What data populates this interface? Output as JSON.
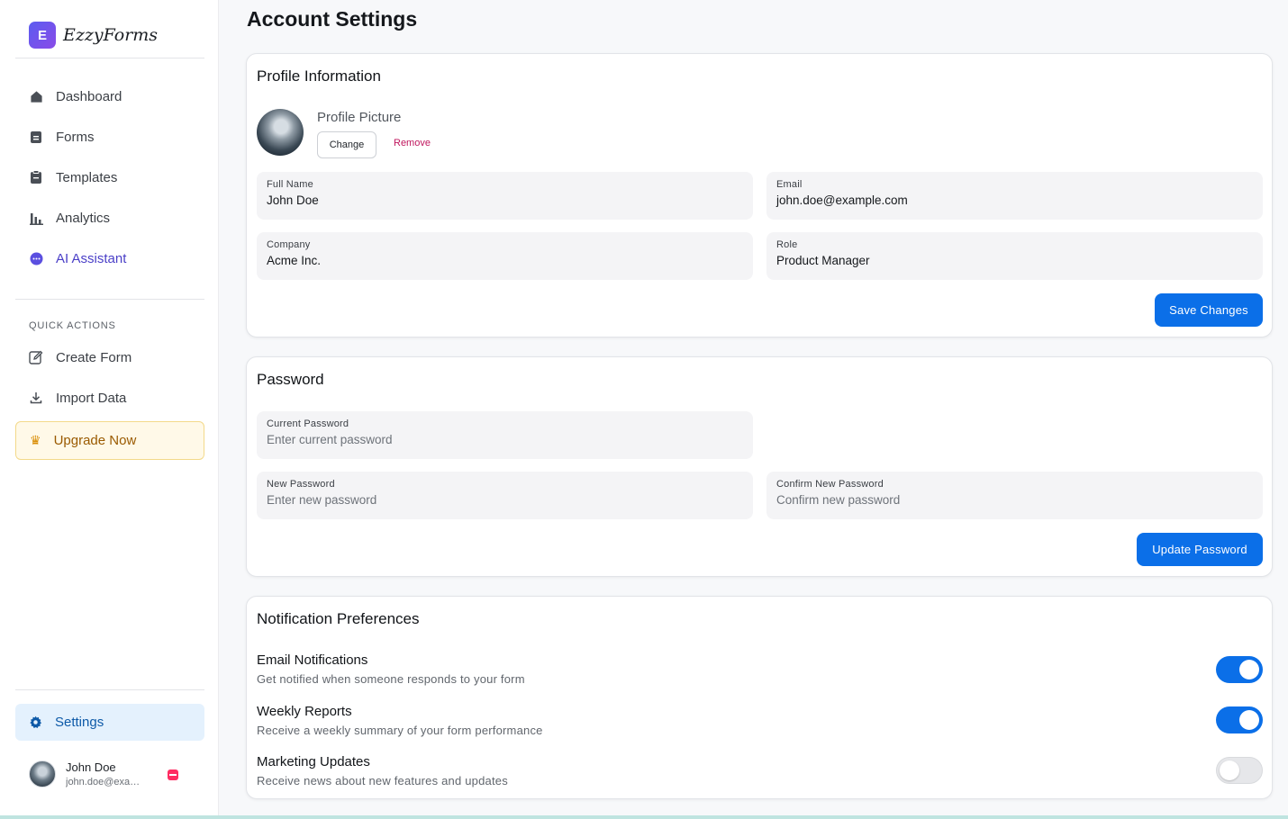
{
  "brand": {
    "badge": "E",
    "name": "EzzyForms"
  },
  "sidebar": {
    "nav": [
      {
        "label": "Dashboard",
        "icon": "home-icon"
      },
      {
        "label": "Forms",
        "icon": "document-icon"
      },
      {
        "label": "Templates",
        "icon": "clipboard-icon"
      },
      {
        "label": "Analytics",
        "icon": "bar-chart-icon"
      },
      {
        "label": "AI Assistant",
        "icon": "chat-bubble-icon"
      }
    ],
    "quick_actions_title": "QUICK ACTIONS",
    "quick_actions": [
      {
        "label": "Create Form",
        "icon": "edit-icon"
      },
      {
        "label": "Import Data",
        "icon": "download-icon"
      }
    ],
    "upgrade_label": "Upgrade Now",
    "settings_label": "Settings",
    "user": {
      "name": "John Doe",
      "email": "john.doe@example.com"
    }
  },
  "page": {
    "title": "Account Settings"
  },
  "profile": {
    "title": "Profile Information",
    "picture_label": "Profile Picture",
    "change_label": "Change",
    "remove_label": "Remove",
    "fields": {
      "full_name": {
        "label": "Full Name",
        "value": "John Doe"
      },
      "email": {
        "label": "Email",
        "value": "john.doe@example.com"
      },
      "company": {
        "label": "Company",
        "value": "Acme Inc."
      },
      "role": {
        "label": "Role",
        "value": "Product Manager"
      }
    },
    "save_label": "Save Changes"
  },
  "password": {
    "title": "Password",
    "fields": {
      "current": {
        "label": "Current Password",
        "placeholder": "Enter current password"
      },
      "new": {
        "label": "New Password",
        "placeholder": "Enter new password"
      },
      "confirm": {
        "label": "Confirm New Password",
        "placeholder": "Confirm new password"
      }
    },
    "update_label": "Update Password"
  },
  "notifications": {
    "title": "Notification Preferences",
    "items": [
      {
        "title": "Email Notifications",
        "desc": "Get notified when someone responds to your form",
        "enabled": true
      },
      {
        "title": "Weekly Reports",
        "desc": "Receive a weekly summary of your form performance",
        "enabled": true
      },
      {
        "title": "Marketing Updates",
        "desc": "Receive news about new features and updates",
        "enabled": false
      }
    ]
  },
  "colors": {
    "primary": "#0b6fe8",
    "settings_bg": "#e4f1fd",
    "upgrade_bg": "#fff9e8",
    "remove": "#c0175e",
    "logout": "#ff2d62"
  }
}
